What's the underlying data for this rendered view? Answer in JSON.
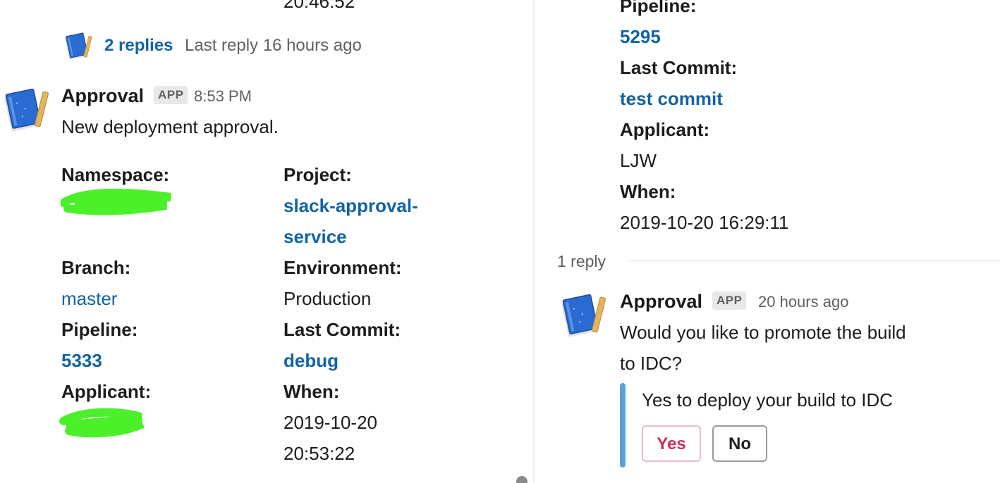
{
  "left": {
    "partial_time": "20:46:52",
    "thread": {
      "replies": "2 replies",
      "last_reply": "Last reply 16 hours ago"
    },
    "message": {
      "sender": "Approval",
      "badge": "APP",
      "time": "8:53 PM",
      "text": "New deployment approval.",
      "fields": {
        "namespace_label": "Namespace:",
        "project_label": "Project:",
        "project_line1": "slack-approval-",
        "project_line2": "service",
        "branch_label": "Branch:",
        "branch": "master",
        "environment_label": "Environment:",
        "environment": "Production",
        "pipeline_label": "Pipeline:",
        "pipeline": "5333",
        "last_commit_label": "Last Commit:",
        "last_commit": "debug",
        "applicant_label": "Applicant:",
        "when_label": "When:",
        "when_date": "2019-10-20",
        "when_time": "20:53:22"
      }
    }
  },
  "right": {
    "pipeline_label": "Pipeline:",
    "pipeline": "5295",
    "last_commit_label": "Last Commit:",
    "last_commit": "test commit",
    "applicant_label": "Applicant:",
    "applicant": "LJW",
    "when_label": "When:",
    "when": "2019-10-20 16:29:11",
    "reply_count": "1 reply",
    "reply": {
      "sender": "Approval",
      "badge": "APP",
      "time": "20 hours ago",
      "text_line1": "Would you like to promote the build",
      "text_line2": "to IDC?",
      "attachment_text": "Yes to deploy your build to IDC",
      "yes_label": "Yes",
      "no_label": "No"
    }
  },
  "colors": {
    "link": "#1264a3",
    "muted": "#616061",
    "attachment_bar": "#5aa2dc",
    "yes_text": "#c9315b",
    "redaction": "#4cf02a"
  },
  "icons": [
    "approval-app-icon",
    "redaction-scribble"
  ]
}
